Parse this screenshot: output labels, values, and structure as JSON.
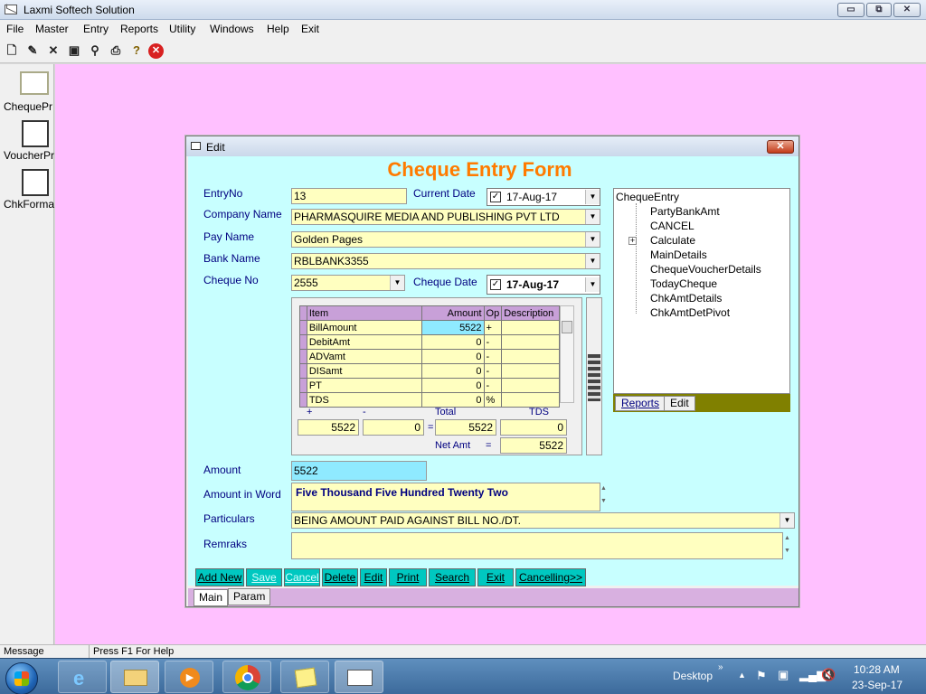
{
  "window": {
    "title": "Laxmi Softech Solution",
    "buttons": {
      "minimize": "▭",
      "restore": "⧉",
      "close": "✕"
    }
  },
  "menu": [
    "File",
    "Master",
    "Entry",
    "Reports",
    "Utility",
    "Windows",
    "Help",
    "Exit"
  ],
  "toolbar_icons": [
    "new-icon",
    "edit-icon",
    "delete-icon",
    "save-icon",
    "find-icon",
    "print-icon",
    "help-icon",
    "close-icon"
  ],
  "sidebar": [
    {
      "label": "ChequePr",
      "icon": "envelope-icon"
    },
    {
      "label": "VoucherPr",
      "icon": "voucher-icon"
    },
    {
      "label": "ChkForma",
      "icon": "format-icon"
    }
  ],
  "dialog": {
    "title": "Edit",
    "close": "✕",
    "form_title": "Cheque Entry Form",
    "labels": {
      "entry_no": "EntryNo",
      "current_date": "Current Date",
      "company": "Company Name",
      "pay_name": "Pay Name",
      "bank": "Bank Name",
      "cheque_no": "Cheque No",
      "cheque_date": "Cheque Date",
      "amount": "Amount",
      "amount_word": "Amount in Word",
      "particulars": "Particulars",
      "remarks": "Remraks"
    },
    "values": {
      "entry_no": "13",
      "current_date": "17-Aug-17",
      "company": "PHARMASQUIRE MEDIA AND PUBLISHING PVT LTD",
      "pay_name": "Golden Pages",
      "bank": "RBLBANK3355",
      "cheque_no": "2555",
      "cheque_date": "17-Aug-17",
      "amount": "5522",
      "amount_word": "Five Thousand Five Hundred Twenty Two",
      "particulars": "BEING AMOUNT PAID AGAINST BILL NO./DT.",
      "remarks": ""
    },
    "grid": {
      "headers": [
        "Item",
        "Amount",
        "Op",
        "Description"
      ],
      "rows": [
        {
          "item": "BillAmount",
          "amount": "5522",
          "op": "+",
          "desc": ""
        },
        {
          "item": "DebitAmt",
          "amount": "0",
          "op": "-",
          "desc": ""
        },
        {
          "item": "ADVamt",
          "amount": "0",
          "op": "-",
          "desc": ""
        },
        {
          "item": "DISamt",
          "amount": "0",
          "op": "-",
          "desc": ""
        },
        {
          "item": "PT",
          "amount": "0",
          "op": "-",
          "desc": ""
        },
        {
          "item": "TDS",
          "amount": "0",
          "op": "%",
          "desc": ""
        }
      ]
    },
    "summary": {
      "plus_label": "+",
      "minus_label": "-",
      "eq_label": "=",
      "total_label": "Total",
      "tds_label": "TDS",
      "net_label": "Net Amt",
      "net_eq": "=",
      "plus": "5522",
      "minus": "0",
      "total": "5522",
      "tds": "0",
      "net": "5522"
    },
    "tree": {
      "root": "ChequeEntry",
      "expander": "+",
      "items": [
        "PartyBankAmt",
        "CANCEL",
        "Calculate",
        "MainDetails",
        "ChequeVoucherDetails",
        "TodayCheque",
        "ChkAmtDetails",
        "ChkAmtDetPivot"
      ]
    },
    "tree_tabs": [
      "Reports",
      "Edit"
    ],
    "buttons": [
      {
        "label": "Add New",
        "enabled": true
      },
      {
        "label": "Save",
        "enabled": false
      },
      {
        "label": "Cancel",
        "enabled": false
      },
      {
        "label": "Delete",
        "enabled": true
      },
      {
        "label": "Edit",
        "enabled": true
      },
      {
        "label": "Print",
        "enabled": true
      },
      {
        "label": "Search",
        "enabled": true
      },
      {
        "label": "Exit",
        "enabled": true
      },
      {
        "label": "Cancelling>>",
        "enabled": true
      }
    ],
    "bottom_tabs": [
      "Main",
      "Param"
    ]
  },
  "status": {
    "message": "Message",
    "help": "Press F1 For Help"
  },
  "taskbar": {
    "desktop": "Desktop",
    "time": "10:28 AM",
    "date": "23-Sep-17"
  }
}
